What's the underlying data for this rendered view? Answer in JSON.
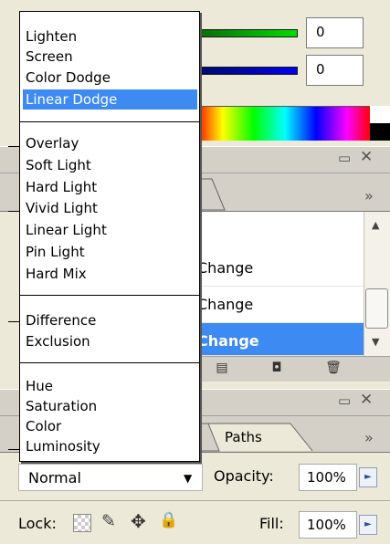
{
  "color_panel": {
    "slider1_value": "0",
    "slider2_value": "0",
    "slider1_color": "#00cc00",
    "slider2_color": "#0000cc"
  },
  "history_panel": {
    "rows": [
      "Change",
      "Change",
      "Change"
    ],
    "selected_index": 2,
    "accent": "#3d8af2"
  },
  "layers_panel": {
    "tab_paths": "Paths",
    "blend_mode": "Normal",
    "opacity_label": "Opacity:",
    "opacity_value": "100%",
    "lock_label": "Lock:",
    "fill_label": "Fill:",
    "fill_value": "100%",
    "collapse_glyph": "»",
    "more_glyph": "»"
  },
  "blend_dropdown": {
    "groups": [
      [
        "Lighten",
        "Screen",
        "Color Dodge",
        "Linear Dodge"
      ],
      [
        "Overlay",
        "Soft Light",
        "Hard Light",
        "Vivid Light",
        "Linear Light",
        "Pin Light",
        "Hard Mix"
      ],
      [
        "Difference",
        "Exclusion"
      ],
      [
        "Hue",
        "Saturation",
        "Color",
        "Luminosity"
      ]
    ],
    "selected": "Linear Dodge"
  }
}
